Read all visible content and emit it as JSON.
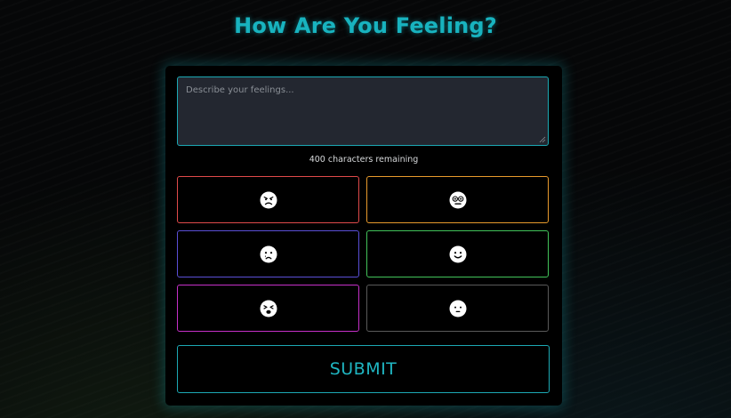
{
  "page": {
    "title": "How Are You Feeling?"
  },
  "form": {
    "textarea_placeholder": "Describe your feelings...",
    "textarea_value": "",
    "counter_text": "400 characters remaining",
    "submit_label": "SUBMIT"
  },
  "moods": [
    {
      "icon": "angry-face-icon",
      "border_color": "#e04a4a"
    },
    {
      "icon": "flushed-face-icon",
      "border_color": "#e89a2c"
    },
    {
      "icon": "sad-tear-face-icon",
      "border_color": "#5a4fd6"
    },
    {
      "icon": "smile-face-icon",
      "border_color": "#42c35a"
    },
    {
      "icon": "tired-face-icon",
      "border_color": "#c530c8"
    },
    {
      "icon": "meh-face-icon",
      "border_color": "#5a5a5a"
    }
  ],
  "colors": {
    "accent": "#18b3bf",
    "card_bg": "#000000",
    "textarea_bg": "#232730"
  }
}
